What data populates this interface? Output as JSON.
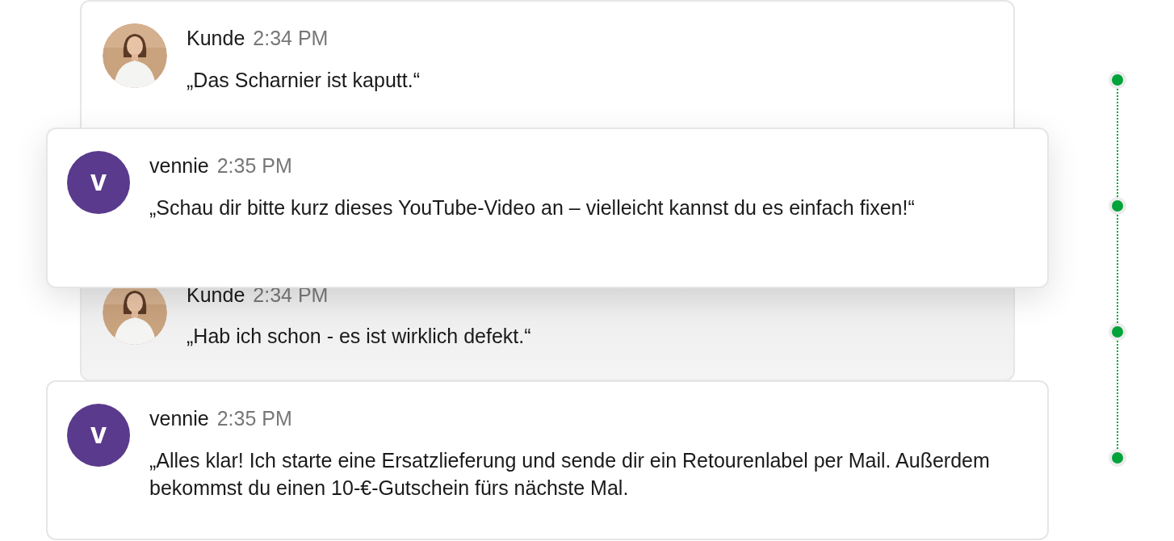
{
  "messages": [
    {
      "kind": "customer",
      "sender": "Kunde",
      "time": "2:34 PM",
      "text": "„Das Scharnier ist kaputt.“",
      "faded": false
    },
    {
      "kind": "agent",
      "initial": "v",
      "sender": "vennie",
      "time": "2:35 PM",
      "text": "„Schau dir bitte kurz dieses YouTube-Video an – vielleicht kannst du es einfach fixen!“",
      "faded": false
    },
    {
      "kind": "customer",
      "sender": "Kunde",
      "time": "2:34 PM",
      "text": "„Hab ich schon - es ist wirklich defekt.“",
      "faded": true
    },
    {
      "kind": "agent",
      "initial": "v",
      "sender": "vennie",
      "time": "2:35 PM",
      "text": "„Alles klar! Ich starte eine Ersatzlieferung und sende dir ein Retourenlabel per Mail. Außerdem bekommst du einen 10-€-Gutschein fürs nächste Mal.",
      "faded": false
    }
  ]
}
